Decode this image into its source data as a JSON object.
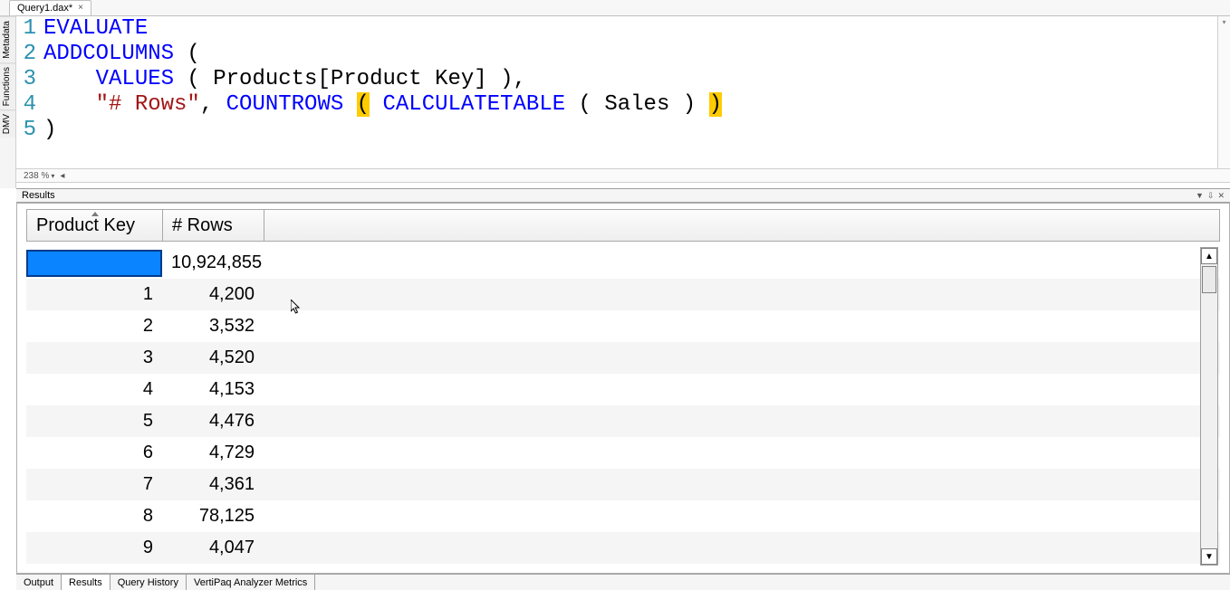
{
  "tab": {
    "title": "Query1.dax*",
    "close": "×"
  },
  "leftRail": {
    "metadata": "Metadata",
    "functions": "Functions",
    "dmv": "DMV"
  },
  "editor": {
    "line1_evaluate": "EVALUATE",
    "line2_addcolumns": "ADDCOLUMNS",
    "line2_paren": " (",
    "line3_indent": "    ",
    "line3_values": "VALUES",
    "line3_rest": " ( Products[Product Key] ),",
    "line4_indent": "    ",
    "line4_str": "\"# Rows\"",
    "line4_comma": ", ",
    "line4_countrows": "COUNTROWS",
    "line4_space": " ",
    "line4_hlopen": "(",
    "line4_space2": " ",
    "line4_calctable": "CALCULATETABLE",
    "line4_mid": " ( Sales ) ",
    "line4_hlclose": ")",
    "line5": ")"
  },
  "zoom": {
    "percent": "238 %",
    "arrow": "◂"
  },
  "resultsPane": {
    "title": "Results"
  },
  "grid": {
    "col1": "Product Key",
    "col2": "# Rows",
    "rows": [
      {
        "k": "",
        "r": "10,924,855",
        "sel": true
      },
      {
        "k": "1",
        "r": "4,200"
      },
      {
        "k": "2",
        "r": "3,532"
      },
      {
        "k": "3",
        "r": "4,520"
      },
      {
        "k": "4",
        "r": "4,153"
      },
      {
        "k": "5",
        "r": "4,476"
      },
      {
        "k": "6",
        "r": "4,729"
      },
      {
        "k": "7",
        "r": "4,361"
      },
      {
        "k": "8",
        "r": "78,125"
      },
      {
        "k": "9",
        "r": "4,047"
      }
    ]
  },
  "bottomTabs": {
    "output": "Output",
    "results": "Results",
    "history": "Query History",
    "vertipaq": "VertiPaq Analyzer Metrics"
  },
  "scroll": {
    "up": "▲",
    "down": "▼"
  },
  "paneIcons": {
    "drop": "▼",
    "pin": "⇩",
    "close": "✕"
  }
}
